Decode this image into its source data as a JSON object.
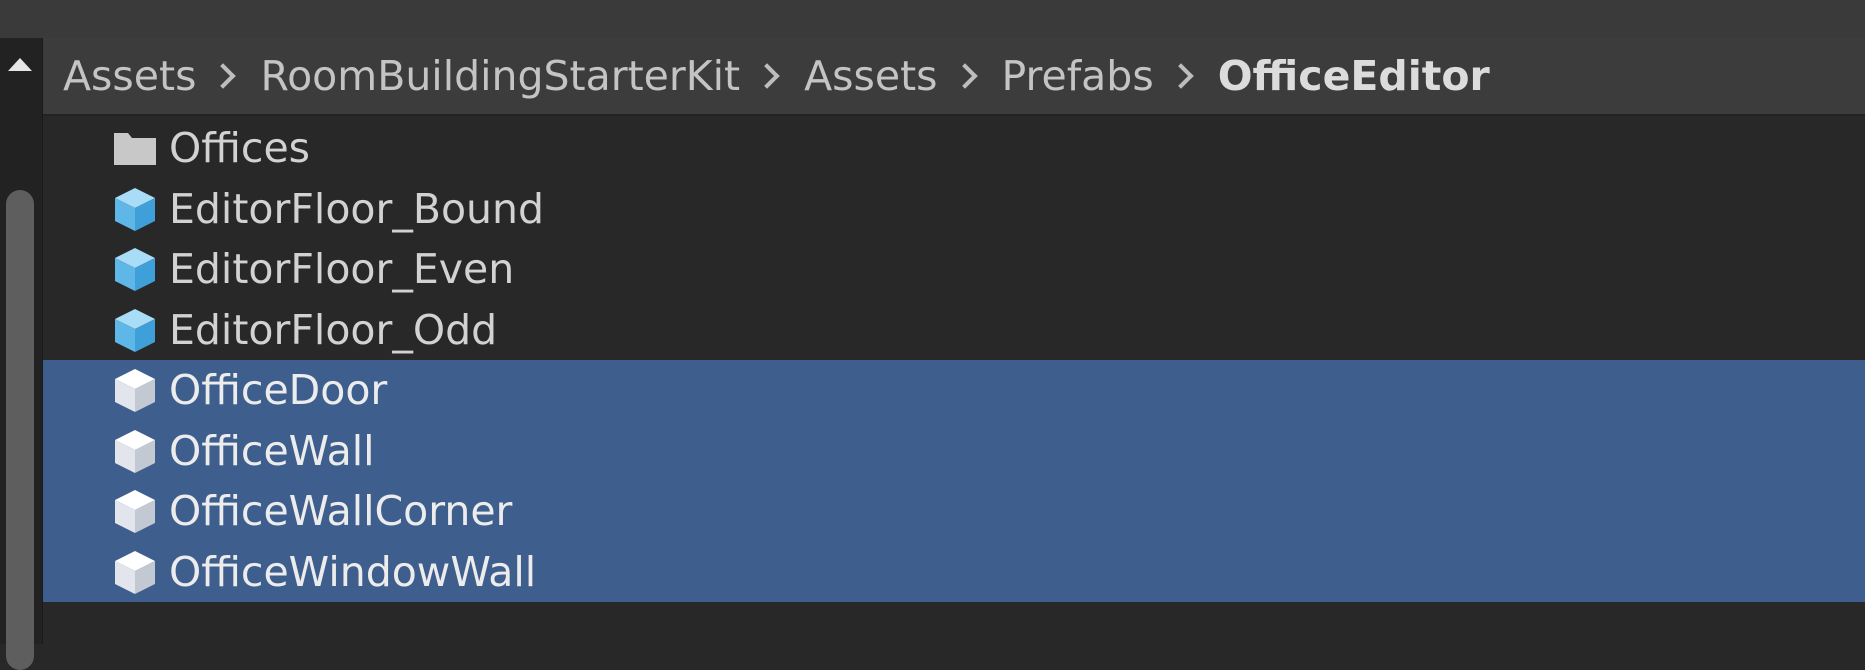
{
  "breadcrumb": {
    "items": [
      "Assets",
      "RoomBuildingStarterKit",
      "Assets",
      "Prefabs",
      "OfficeEditor"
    ]
  },
  "files": [
    {
      "label": "Offices",
      "icon": "folder-icon",
      "selected": false
    },
    {
      "label": "EditorFloor_Bound",
      "icon": "prefab-cube-icon",
      "selected": false
    },
    {
      "label": "EditorFloor_Even",
      "icon": "prefab-cube-icon",
      "selected": false
    },
    {
      "label": "EditorFloor_Odd",
      "icon": "prefab-cube-icon",
      "selected": false
    },
    {
      "label": "OfficeDoor",
      "icon": "prefab-cube-white-icon",
      "selected": true
    },
    {
      "label": "OfficeWall",
      "icon": "prefab-cube-white-icon",
      "selected": true
    },
    {
      "label": "OfficeWallCorner",
      "icon": "prefab-cube-white-icon",
      "selected": true
    },
    {
      "label": "OfficeWindowWall",
      "icon": "prefab-cube-white-icon",
      "selected": true
    }
  ],
  "colors": {
    "background": "#282828",
    "breadcrumb_bar": "#3c3c3c",
    "selection": "#3e5e8d",
    "prefab_blue": "#7ec8f2"
  }
}
